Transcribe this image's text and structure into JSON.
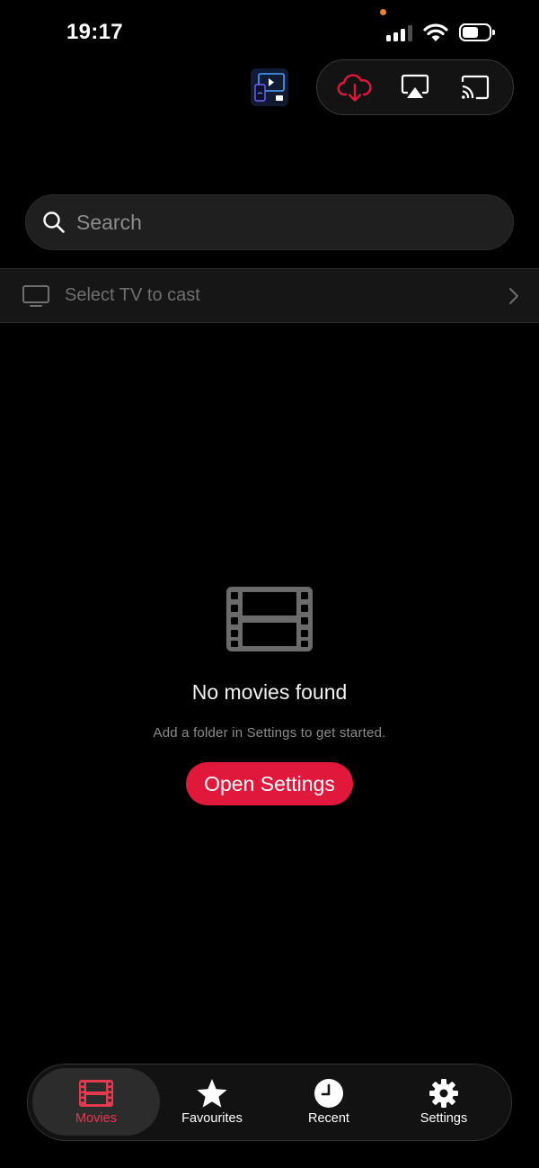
{
  "status_bar": {
    "time": "19:17"
  },
  "top_controls": {
    "items": [
      "app-badge",
      "cloud-download-icon",
      "airplay-icon",
      "cast-icon"
    ]
  },
  "search": {
    "placeholder": "Search"
  },
  "cast_row": {
    "label": "Select TV to cast"
  },
  "empty_state": {
    "title": "No movies found",
    "subtitle": "Add a folder in Settings to get started.",
    "button_label": "Open Settings"
  },
  "tab_bar": {
    "tabs": [
      {
        "label": "Movies",
        "icon": "film-icon",
        "active": true
      },
      {
        "label": "Favourites",
        "icon": "star-icon",
        "active": false
      },
      {
        "label": "Recent",
        "icon": "clock-icon",
        "active": false
      },
      {
        "label": "Settings",
        "icon": "gear-icon",
        "active": false
      }
    ]
  },
  "colors": {
    "accent": "#e0183c",
    "active_tab_label": "#e33a4f",
    "background": "#000000"
  }
}
